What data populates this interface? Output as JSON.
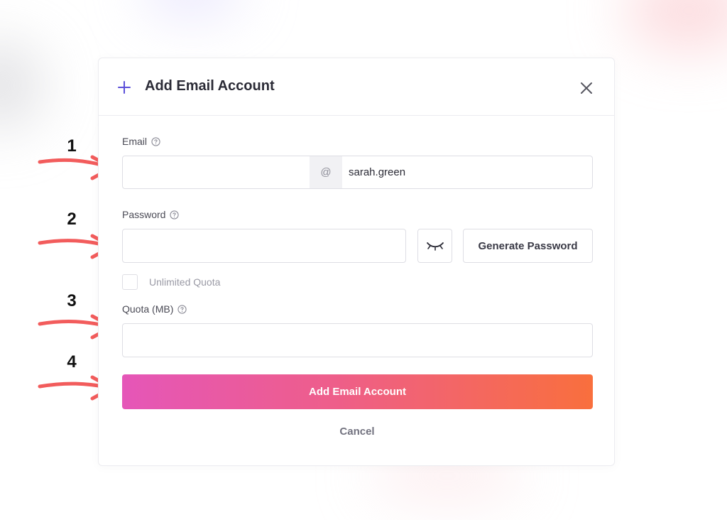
{
  "modal": {
    "title": "Add Email Account",
    "header_icon": "plus-icon",
    "close_icon": "close-icon"
  },
  "email": {
    "label": "Email",
    "local_value": "",
    "at": "@",
    "domain_value": "sarah.green"
  },
  "password": {
    "label": "Password",
    "value": "",
    "toggle_icon": "eye-closed-icon",
    "generate_label": "Generate Password"
  },
  "unlimited_quota": {
    "label": "Unlimited Quota",
    "checked": false
  },
  "quota": {
    "label": "Quota (MB)",
    "value": ""
  },
  "actions": {
    "submit_label": "Add Email Account",
    "cancel_label": "Cancel"
  },
  "annotations": {
    "numbers": [
      "1",
      "2",
      "3",
      "4"
    ],
    "arrow_color": "#f25c5c"
  },
  "colors": {
    "accent": "#5b4fd9",
    "gradient_start": "#e556b8",
    "gradient_end": "#f96f3d"
  }
}
